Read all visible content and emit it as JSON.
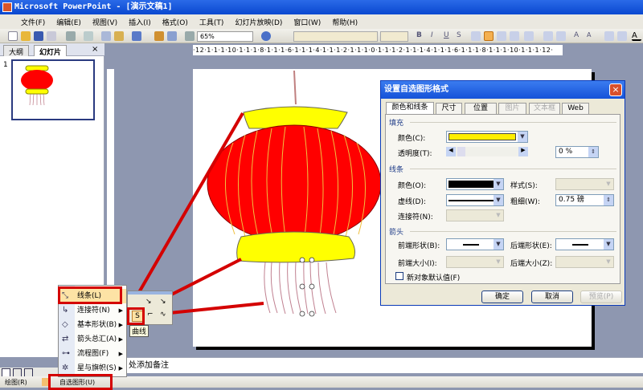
{
  "title": "Microsoft PowerPoint - [演示文稿1]",
  "menubar": [
    "文件(F)",
    "编辑(E)",
    "视图(V)",
    "插入(I)",
    "格式(O)",
    "工具(T)",
    "幻灯片放映(D)",
    "窗口(W)",
    "帮助(H)"
  ],
  "toolbar": {
    "zoom": "65%"
  },
  "left_panel": {
    "tabs": [
      "大纲",
      "幻灯片"
    ],
    "close": "×",
    "slide_number": "1"
  },
  "ruler": "·12·1·1·1·10·1·1·1·8·1·1·1·6·1·1·1·4·1·1·1·2·1·1·1·0·1·1·1·2·1·1·1·4·1·1·1·6·1·1·1·8·1·1·1·10·1·1·1·12·",
  "dialog": {
    "title": "设置自选图形格式",
    "close": "×",
    "tabs": [
      {
        "label": "颜色和线条",
        "enabled": true
      },
      {
        "label": "尺寸",
        "enabled": true
      },
      {
        "label": "位置",
        "enabled": true
      },
      {
        "label": "图片",
        "enabled": false
      },
      {
        "label": "文本框",
        "enabled": false
      },
      {
        "label": "Web",
        "enabled": true
      }
    ],
    "fill": {
      "heading": "填充",
      "color_label": "颜色(C):",
      "color_value": "#ffee00",
      "transparency_label": "透明度(T):",
      "transparency_value": "0 %"
    },
    "line": {
      "heading": "线条",
      "color_label": "颜色(O):",
      "color_value": "#000000",
      "style_label": "样式(S):",
      "dash_label": "虚线(D):",
      "weight_label": "粗细(W):",
      "weight_value": "0.75 磅",
      "connector_label": "连接符(N):"
    },
    "arrows": {
      "heading": "箭头",
      "begin_style_label": "前端形状(B):",
      "end_style_label": "后端形状(E):",
      "begin_size_label": "前端大小(I):",
      "end_size_label": "后端大小(Z):"
    },
    "default_checkbox": "新对象默认值(F)",
    "buttons": {
      "ok": "确定",
      "cancel": "取消",
      "preview": "预览(P)"
    }
  },
  "autoshape_menu": [
    {
      "label": "线条(L)",
      "icon": "lines-icon"
    },
    {
      "label": "连接符(N)",
      "icon": "connector-icon"
    },
    {
      "label": "基本形状(B)",
      "icon": "basic-shapes-icon"
    },
    {
      "label": "箭头总汇(A)",
      "icon": "block-arrows-icon"
    },
    {
      "label": "流程图(F)",
      "icon": "flowchart-icon"
    },
    {
      "label": "星与旗帜(S)",
      "icon": "stars-banners-icon"
    }
  ],
  "submenu": {
    "tooltip": "曲线"
  },
  "notes": "处添加备注",
  "drawbar": {
    "draw": "绘图(R)",
    "autoshapes": "自选图形(U)"
  },
  "colors": {
    "lantern_red": "#ff0000",
    "lantern_yellow": "#ffff00",
    "highlight": "#d40000"
  }
}
